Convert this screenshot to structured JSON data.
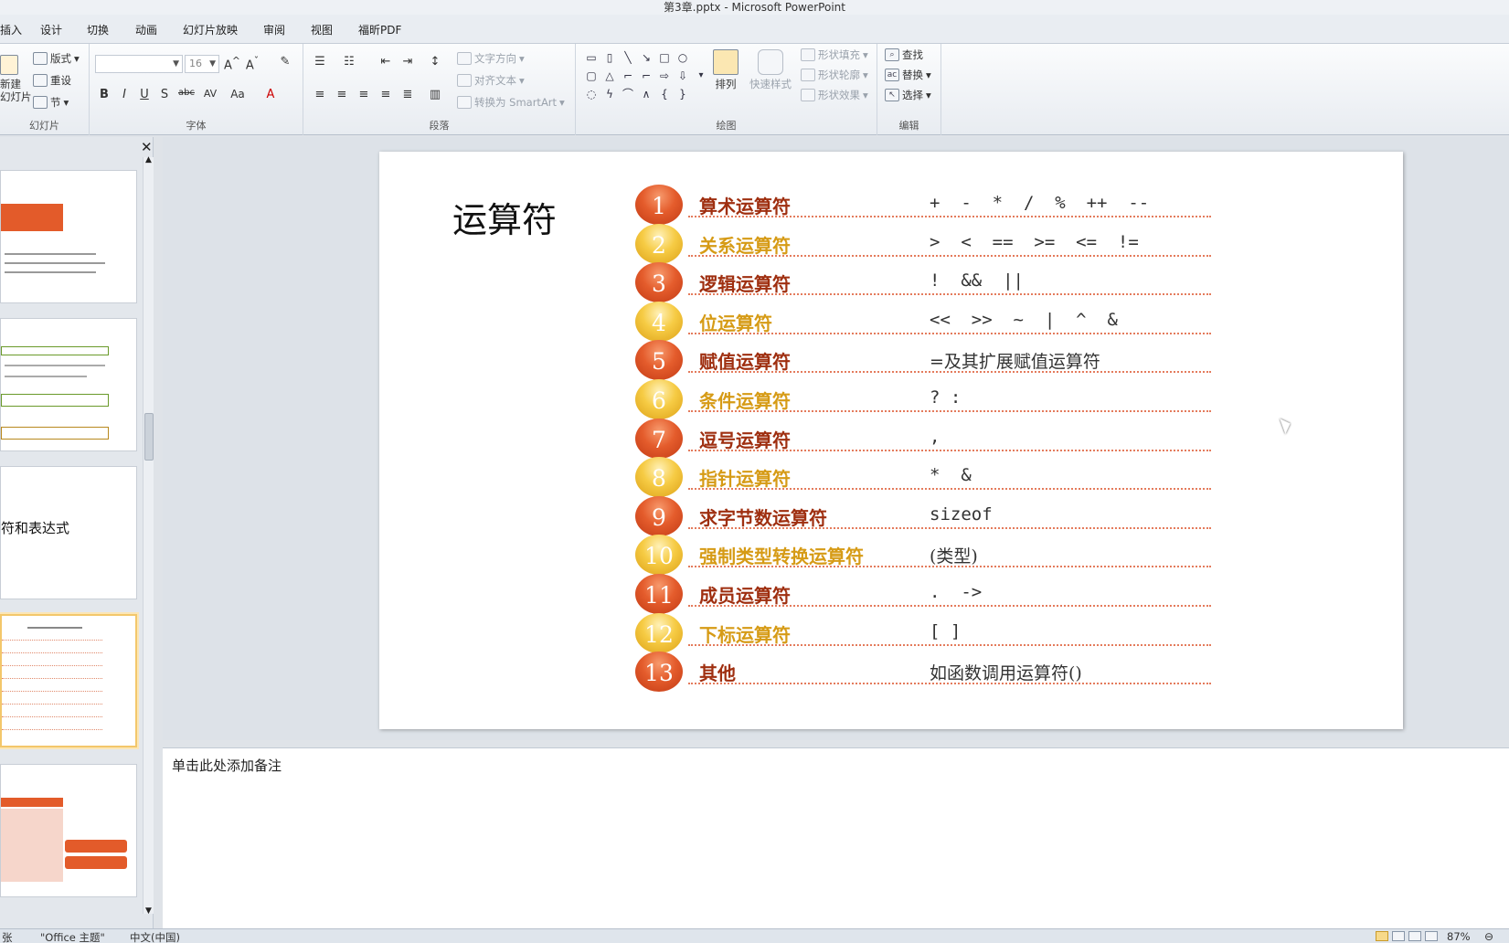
{
  "window": {
    "title": "第3章.pptx - Microsoft PowerPoint"
  },
  "tabs": [
    "插入",
    "设计",
    "切换",
    "动画",
    "幻灯片放映",
    "审阅",
    "视图",
    "福昕PDF"
  ],
  "ribbon": {
    "slides_group": {
      "label": "幻灯片",
      "new_slide": "新建\n幻灯片",
      "layout": "版式",
      "reset": "重设",
      "section": "节"
    },
    "font_group": {
      "label": "字体",
      "font_name": "",
      "font_size": "16"
    },
    "paragraph_group": {
      "label": "段落",
      "text_direction": "文字方向",
      "align_text": "对齐文本",
      "smartart": "转换为 SmartArt"
    },
    "drawing_group": {
      "label": "绘图",
      "arrange": "排列",
      "quick_styles": "快速样式",
      "shape_fill": "形状填充",
      "shape_outline": "形状轮廓",
      "shape_effects": "形状效果"
    },
    "editing_group": {
      "label": "编辑",
      "find": "查找",
      "replace": "替换",
      "select": "选择"
    }
  },
  "slide": {
    "title": "运算符",
    "rows": [
      {
        "num": "1",
        "name": "算术运算符",
        "ops": "+  -  *  /  %  ++  --",
        "style": "red"
      },
      {
        "num": "2",
        "name": "关系运算符",
        "ops": ">  <  ==  >=  <=  !=",
        "style": "gold"
      },
      {
        "num": "3",
        "name": "逻辑运算符",
        "ops": "!  &&  ||",
        "style": "red"
      },
      {
        "num": "4",
        "name": "位运算符",
        "ops": "<<  >>  ~  |  ^  &",
        "style": "gold"
      },
      {
        "num": "5",
        "name": "赋值运算符",
        "ops": "=及其扩展赋值运算符",
        "style": "red"
      },
      {
        "num": "6",
        "name": "条件运算符",
        "ops": "? :",
        "style": "gold"
      },
      {
        "num": "7",
        "name": "逗号运算符",
        "ops": ",",
        "style": "red"
      },
      {
        "num": "8",
        "name": "指针运算符",
        "ops": "*  &",
        "style": "gold"
      },
      {
        "num": "9",
        "name": "求字节数运算符",
        "ops": "sizeof",
        "style": "red"
      },
      {
        "num": "10",
        "name": "强制类型转换运算符",
        "ops": "(类型)",
        "style": "gold"
      },
      {
        "num": "11",
        "name": "成员运算符",
        "ops": ".  ->",
        "style": "red"
      },
      {
        "num": "12",
        "name": "下标运算符",
        "ops": "[ ]",
        "style": "gold"
      },
      {
        "num": "13",
        "name": "其他",
        "ops": "如函数调用运算符()",
        "style": "red"
      }
    ]
  },
  "thumbnails": {
    "slide3_text": "符和表达式"
  },
  "notes": {
    "placeholder": "单击此处添加备注"
  },
  "statusbar": {
    "slide_count": "张",
    "theme": "\"Office 主题\"",
    "language": "中文(中国)",
    "zoom": "87%"
  }
}
